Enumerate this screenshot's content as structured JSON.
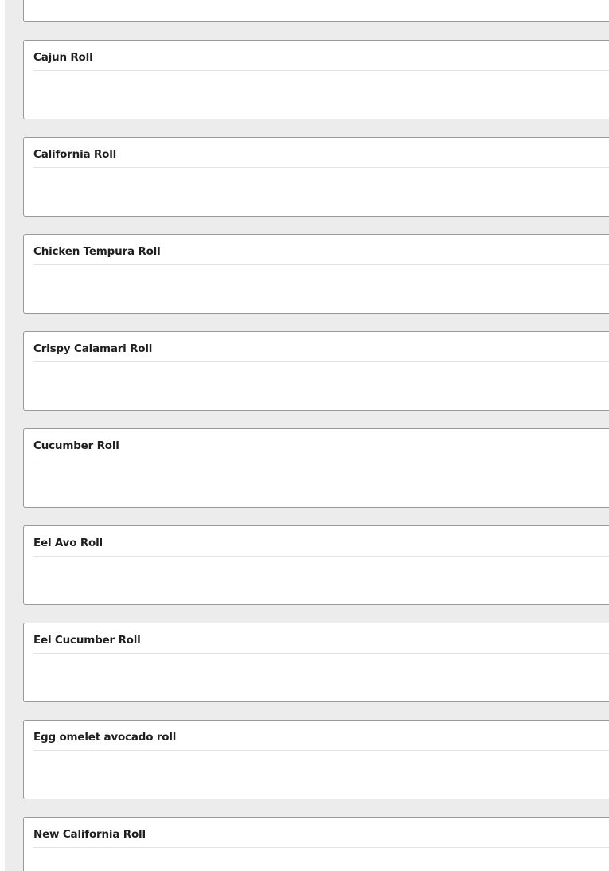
{
  "menu": {
    "items": [
      {
        "name": ""
      },
      {
        "name": "Cajun Roll"
      },
      {
        "name": "California Roll"
      },
      {
        "name": "Chicken Tempura Roll"
      },
      {
        "name": "Crispy Calamari Roll"
      },
      {
        "name": "Cucumber Roll"
      },
      {
        "name": "Eel Avo Roll"
      },
      {
        "name": "Eel Cucumber Roll"
      },
      {
        "name": "Egg omelet avocado roll"
      },
      {
        "name": "New California Roll"
      }
    ]
  },
  "colors": {
    "page_background": "#ececec",
    "card_background": "#ffffff",
    "card_border": "#9a9a9a",
    "divider": "#e3e3e3",
    "text": "#1f1f1f"
  }
}
